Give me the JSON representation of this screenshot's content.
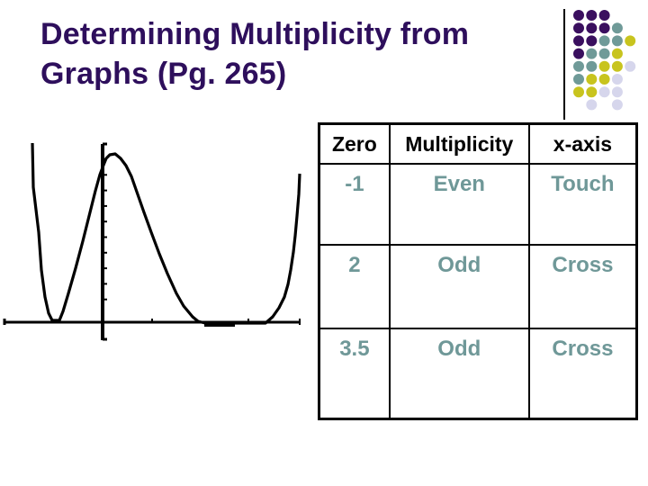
{
  "slide": {
    "title_lines": [
      "Determining Multiplicity from",
      "Graphs (Pg. 265)"
    ],
    "colors": {
      "title": "#2e0f5c",
      "cell_value": "#6f9898",
      "dot_purple": "#3a0f5f",
      "dot_teal": "#6f9a98",
      "dot_yellow": "#c8c41e",
      "dot_lavender": "#d6d6ec"
    },
    "decoration": {
      "dot_grid": [
        [
          "purple",
          "purple",
          "purple",
          null,
          null
        ],
        [
          "purple",
          "purple",
          "purple",
          "teal",
          null
        ],
        [
          "purple",
          "purple",
          "teal",
          "teal",
          "yellow"
        ],
        [
          "purple",
          "teal",
          "teal",
          "yellow",
          null
        ],
        [
          "teal",
          "teal",
          "yellow",
          "yellow",
          "lavender"
        ],
        [
          "teal",
          "yellow",
          "yellow",
          "lavender",
          null
        ],
        [
          "yellow",
          "yellow",
          "lavender",
          "lavender",
          null
        ],
        [
          null,
          "lavender",
          null,
          "lavender",
          null
        ]
      ]
    }
  },
  "table": {
    "headers": [
      "Zero",
      "Multiplicity",
      "x-axis"
    ],
    "rows": [
      [
        "-1",
        "Even",
        "Touch"
      ],
      [
        "2",
        "Odd",
        "Cross"
      ],
      [
        "3.5",
        "Odd",
        "Cross"
      ]
    ]
  },
  "chart_data": {
    "type": "line",
    "title": "",
    "xlabel": "",
    "ylabel": "",
    "description": "Polynomial graph (calculator style) touching the x-axis at x=-1 and crossing (flattening) near x=3.5, with a peak just right of the y-axis",
    "zeros": [
      {
        "x": -1,
        "behavior": "touch"
      },
      {
        "x": 2,
        "behavior": "cross"
      },
      {
        "x": 3.5,
        "behavior": "cross"
      }
    ],
    "xlim": [
      -2,
      4
    ],
    "grid": false,
    "axis_ticks": true
  }
}
